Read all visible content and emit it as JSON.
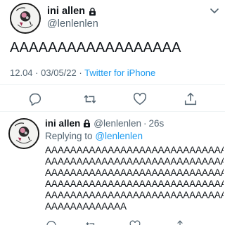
{
  "tweet": {
    "display_name": "ini allen",
    "handle": "@lenlenlen",
    "text": "AAAAAAAAAAAAAAAAAA",
    "time": "12.04",
    "date": "03/05/22",
    "separator": "·",
    "source": "Twitter for iPhone",
    "avatar_icon": "profile-avatar-icon",
    "lock_icon": "protected-lock-icon",
    "menu_icon": "chevron-down-icon",
    "actions": [
      "reply-icon",
      "retweet-icon",
      "like-icon",
      "share-icon"
    ]
  },
  "reply": {
    "display_name": "ini allen",
    "handle": "@lenlenlen",
    "separator": "·",
    "age": "26s",
    "replying_prefix": "Replying to",
    "replying_to": "@lenlenlen",
    "lines": [
      "AAAAAAAAAAAAAAAAAAAAAAAAAAAAA",
      "AAAAAAAAAAAAAAAAAAAAAAAAAAAAA",
      "AAAAAAAAAAAAAAAAAAAAAAAAAAAAA",
      "AAAAAAAAAAAAAAAAAAAAAAAAAAAAA",
      "AAAAAAAAAAAAAAAAAAAAAAAAAAAAA",
      "AAAAAAAAAAAAA"
    ]
  },
  "colors": {
    "text": "#0f1419",
    "secondary": "#536471",
    "accent": "#1d9bf0",
    "divider": "#eff3f4"
  }
}
